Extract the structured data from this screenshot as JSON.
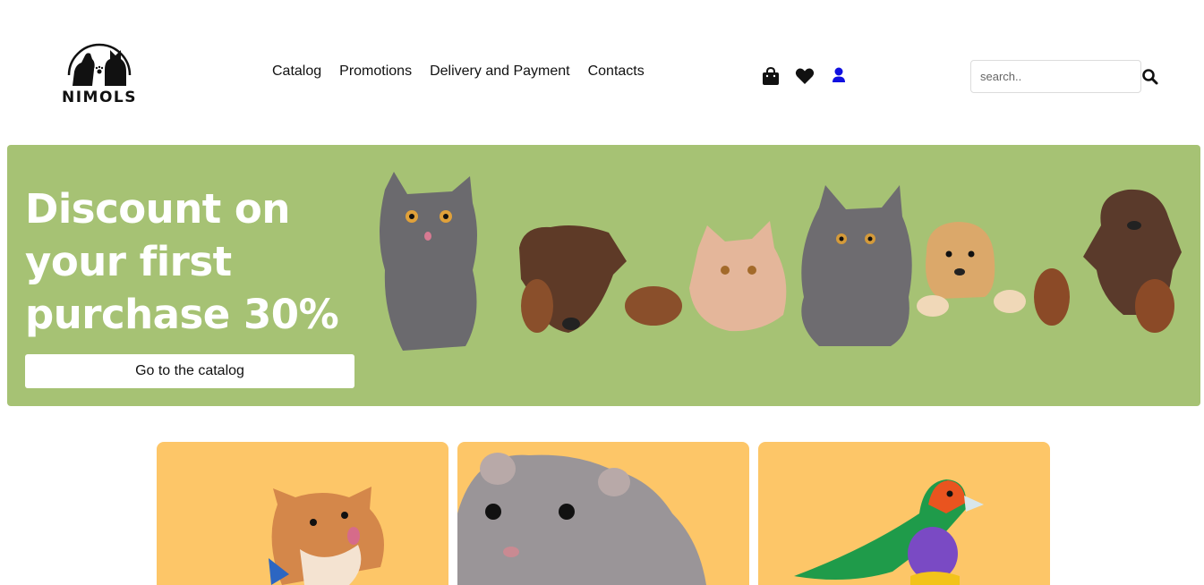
{
  "brand": {
    "name": "NIMOLS"
  },
  "nav": {
    "items": [
      {
        "label": "Catalog"
      },
      {
        "label": "Promotions"
      },
      {
        "label": "Delivery and Payment"
      },
      {
        "label": "Contacts"
      }
    ]
  },
  "header_icons": [
    "shopping-bag-icon",
    "heart-icon",
    "user-icon"
  ],
  "search": {
    "placeholder": "search..",
    "value": ""
  },
  "hero": {
    "title": "Discount on your first purchase 30%",
    "button_label": "Go to the catalog",
    "background": "#a6c274"
  },
  "categories": [
    {
      "animal": "dog"
    },
    {
      "animal": "hamster"
    },
    {
      "animal": "bird"
    }
  ],
  "colors": {
    "card_background": "#fdc668",
    "user_icon": "#1010e0",
    "hero_background": "#a6c274"
  }
}
